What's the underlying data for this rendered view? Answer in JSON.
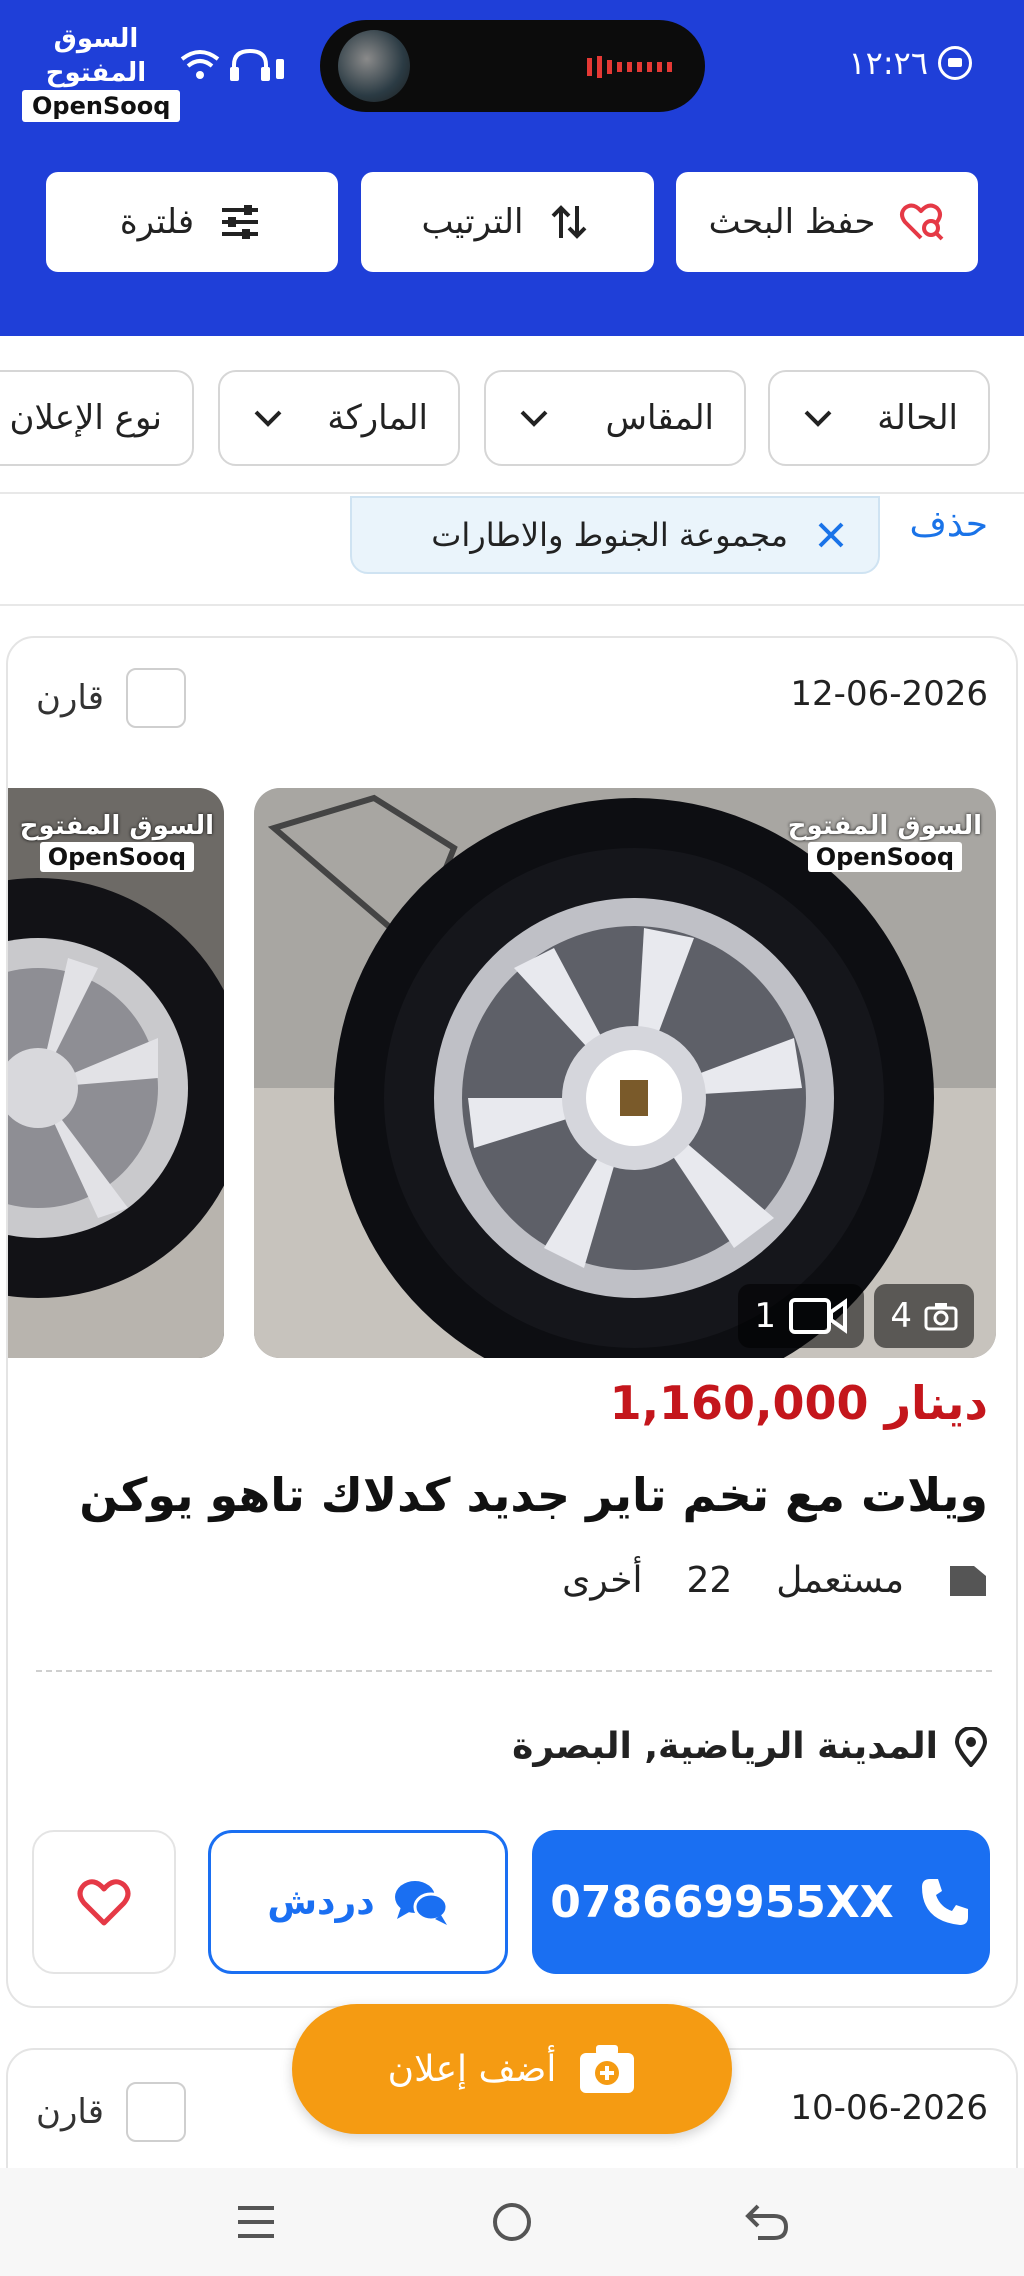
{
  "status_bar": {
    "logo_ar": "السوق المفتوح",
    "logo_en": "OpenSooq",
    "time": "١٢:٢٦"
  },
  "toolbar": {
    "save_search_label": "حفظ البحث",
    "sort_label": "الترتيب",
    "filter_label": "فلترة"
  },
  "filter_chips": [
    {
      "label": "الحالة"
    },
    {
      "label": "المقاس"
    },
    {
      "label": "الماركة"
    },
    {
      "label": "نوع الإعلان"
    }
  ],
  "active_filter": {
    "delete_label": "حذف",
    "tag_label": "مجموعة الجنوط والاطارات"
  },
  "listing": {
    "date": "12-06-2026",
    "compare_label": "قارن",
    "watermark_ar": "السوق المفتوح",
    "watermark_en": "OpenSooq",
    "photo_count": "4",
    "video_count": "1",
    "price": "1,160,000 دينار",
    "title": "ويلات مع تخم تاير جديد كدلاك تاهو يوكن",
    "condition": "مستعمل",
    "size": "22",
    "type": "أخرى",
    "location": "المدينة الرياضية, البصرة",
    "phone": "078669955XX",
    "chat_label": "دردش",
    "accent_color": "#1a6ff2",
    "price_color": "#c4161c"
  },
  "listing_2": {
    "date": "10-06-2026",
    "compare_label": "قارن"
  },
  "fab": {
    "label": "أضف إعلان",
    "color": "#f59b12"
  },
  "header_color": "#1f3fd8"
}
